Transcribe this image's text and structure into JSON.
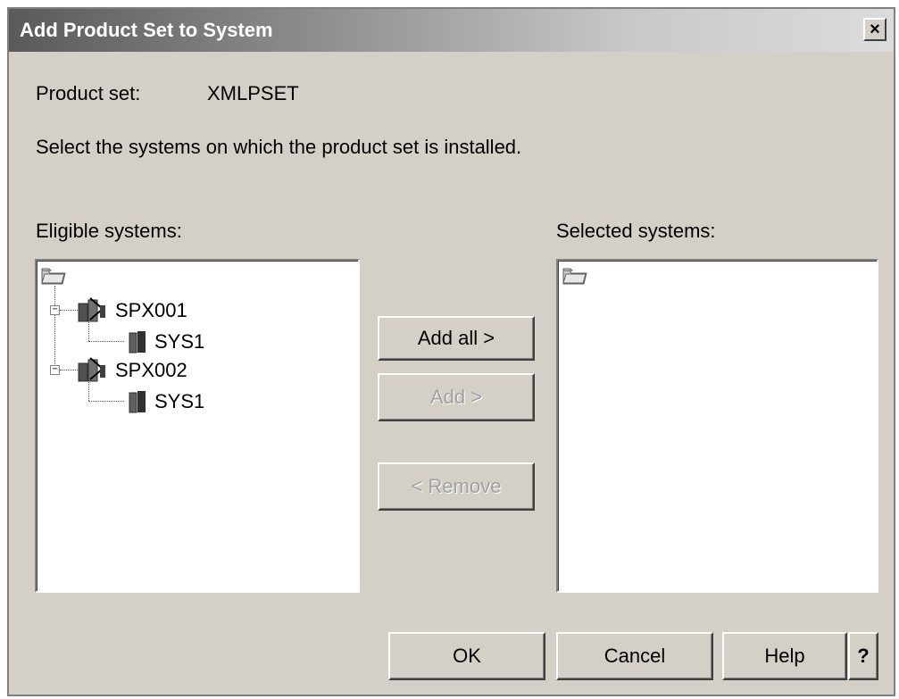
{
  "window": {
    "title": "Add Product Set to System",
    "close_glyph": "×"
  },
  "product_set": {
    "label": "Product set:",
    "value": "XMLPSET"
  },
  "instruction": "Select the systems on which the product set is installed.",
  "eligible": {
    "label": "Eligible systems:",
    "root_icon": "folder-icon",
    "groups": [
      {
        "name": "SPX001",
        "expanded": true,
        "children": [
          "SYS1"
        ]
      },
      {
        "name": "SPX002",
        "expanded": true,
        "children": [
          "SYS1"
        ]
      }
    ]
  },
  "selected": {
    "label": "Selected systems:",
    "root_icon": "folder-icon"
  },
  "transfer_buttons": {
    "add_all": "Add all >",
    "add": "Add >",
    "remove": "< Remove"
  },
  "footer_buttons": {
    "ok": "OK",
    "cancel": "Cancel",
    "help": "Help",
    "context_help": "?"
  },
  "colors": {
    "dialog_bg": "#d4d0c8",
    "list_bg": "#ffffff",
    "disabled_text": "#a0a0a0"
  }
}
